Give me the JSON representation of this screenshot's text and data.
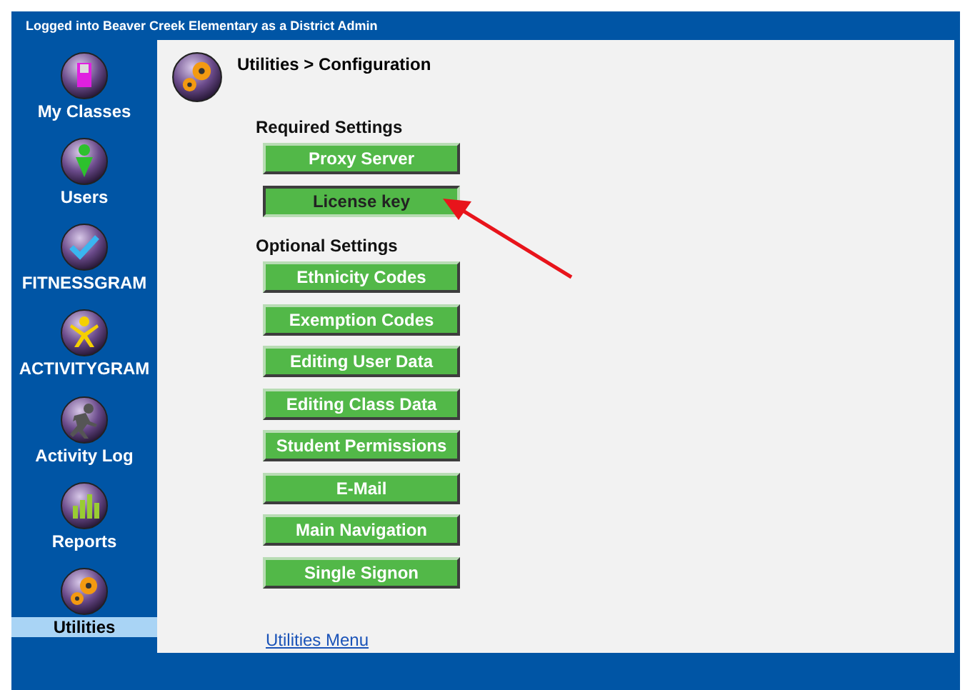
{
  "header": {
    "text": "Logged into Beaver Creek Elementary as a District Admin"
  },
  "sidebar": {
    "items": [
      {
        "label": "My Classes",
        "kind": "door",
        "selected": false
      },
      {
        "label": "Users",
        "kind": "person",
        "selected": false
      },
      {
        "label": "FITNESSGRAM",
        "kind": "check",
        "selected": false
      },
      {
        "label": "ACTIVITYGRAM",
        "kind": "jump",
        "selected": false
      },
      {
        "label": "Activity Log",
        "kind": "run",
        "selected": false
      },
      {
        "label": "Reports",
        "kind": "bars",
        "selected": false
      },
      {
        "label": "Utilities",
        "kind": "gears",
        "selected": true
      }
    ]
  },
  "breadcrumb": "Utilities > Configuration",
  "sections": [
    {
      "title": "Required Settings",
      "buttons": [
        {
          "label": "Proxy Server",
          "selected": false
        },
        {
          "label": "License key",
          "selected": true
        }
      ]
    },
    {
      "title": "Optional Settings",
      "buttons": [
        {
          "label": "Ethnicity Codes",
          "selected": false
        },
        {
          "label": "Exemption Codes",
          "selected": false
        },
        {
          "label": "Editing User Data",
          "selected": false
        },
        {
          "label": "Editing Class Data",
          "selected": false
        },
        {
          "label": "Student Permissions",
          "selected": false
        },
        {
          "label": "E-Mail",
          "selected": false
        },
        {
          "label": "Main Navigation",
          "selected": false
        },
        {
          "label": "Single Signon",
          "selected": false
        }
      ]
    }
  ],
  "footer_link": "Utilities Menu"
}
